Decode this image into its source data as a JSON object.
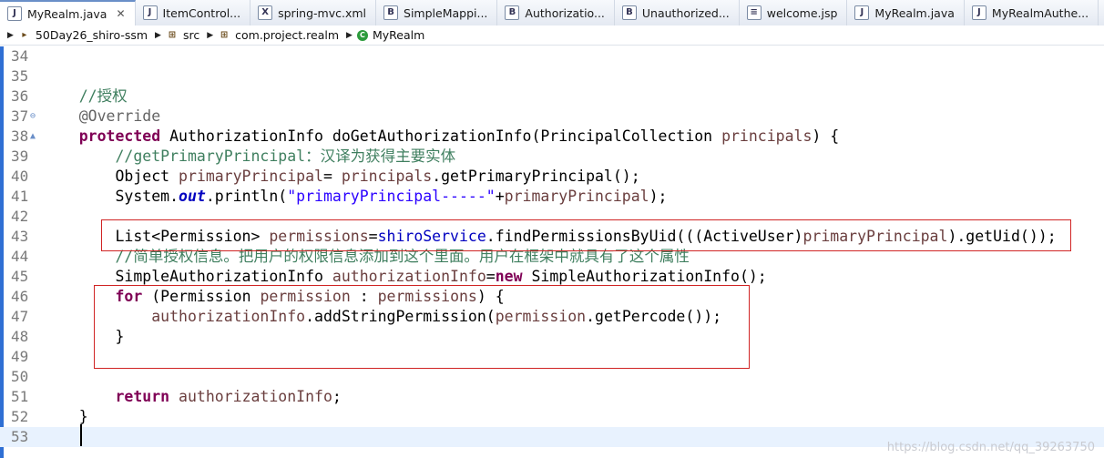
{
  "tabs": [
    {
      "label": "MyRealm.java",
      "icon": "J",
      "active": true
    },
    {
      "label": "ItemControl...",
      "icon": "J"
    },
    {
      "label": "spring-mvc.xml",
      "icon": "X"
    },
    {
      "label": "SimpleMappi...",
      "icon": "B"
    },
    {
      "label": "Authorizatio...",
      "icon": "B"
    },
    {
      "label": "Unauthorized...",
      "icon": "B"
    },
    {
      "label": "welcome.jsp",
      "icon": "≡"
    },
    {
      "label": "MyRealm.java",
      "icon": "J"
    },
    {
      "label": "MyRealmAuthe...",
      "icon": "J"
    }
  ],
  "breadcrumb": [
    {
      "label": "50Day26_shiro-ssm",
      "icon": "▸"
    },
    {
      "label": "src",
      "icon": "⊞"
    },
    {
      "label": "com.project.realm",
      "icon": "⊞"
    },
    {
      "label": "MyRealm",
      "icon": "C"
    }
  ],
  "editor": {
    "lines": [
      {
        "n": "34",
        "html": ""
      },
      {
        "n": "35",
        "html": ""
      },
      {
        "n": "36",
        "html": "    <span class='cm'>//授权</span>"
      },
      {
        "n": "37",
        "mark": "⊖",
        "html": "    <span class='an'>@Override</span>"
      },
      {
        "n": "38",
        "mark": "▲",
        "html": "    <span class='kw'>protected</span> AuthorizationInfo doGetAuthorizationInfo(PrincipalCollection <span class='var'>principals</span>) {"
      },
      {
        "n": "39",
        "html": "        <span class='cm'>//getPrimaryPrincipal：汉译为获得主要实体</span>"
      },
      {
        "n": "40",
        "html": "        Object <span class='var'>primaryPrincipal</span>= <span class='var'>principals</span>.getPrimaryPrincipal();"
      },
      {
        "n": "41",
        "html": "        System.<span class='sfld'>out</span>.println(<span class='str'>\"primaryPrincipal-----\"</span>+<span class='var'>primaryPrincipal</span>);"
      },
      {
        "n": "42",
        "html": ""
      },
      {
        "n": "43",
        "html": "        List&lt;Permission&gt; <span class='var'>permissions</span>=<span class='fld'>shiroService</span>.findPermissionsByUid(((ActiveUser)<span class='var'>primaryPrincipal</span>).getUid());"
      },
      {
        "n": "44",
        "html": "        <span class='cm'>//简单授权信息。把用户的权限信息添加到这个里面。用户在框架中就具有了这个属性</span>"
      },
      {
        "n": "45",
        "html": "        SimpleAuthorizationInfo <span class='var'>authorizationInfo</span>=<span class='kw'>new</span> SimpleAuthorizationInfo();"
      },
      {
        "n": "46",
        "html": "        <span class='kw'>for</span> (Permission <span class='var'>permission</span> : <span class='var'>permissions</span>) {"
      },
      {
        "n": "47",
        "html": "            <span class='var'>authorizationInfo</span>.addStringPermission(<span class='var'>permission</span>.getPercode());"
      },
      {
        "n": "48",
        "html": "        }"
      },
      {
        "n": "49",
        "html": ""
      },
      {
        "n": "50",
        "html": ""
      },
      {
        "n": "51",
        "html": "        <span class='kw'>return</span> <span class='var'>authorizationInfo</span>;"
      },
      {
        "n": "52",
        "html": "    }"
      },
      {
        "n": "53",
        "html": "",
        "current": true
      }
    ]
  },
  "watermark": "https://blog.csdn.net/qq_39263750",
  "colors": {
    "keyword": "#7f0055",
    "comment": "#3f7f5f",
    "string": "#2a00ff",
    "field": "#0000c0",
    "highlight_box": "#d02424"
  }
}
